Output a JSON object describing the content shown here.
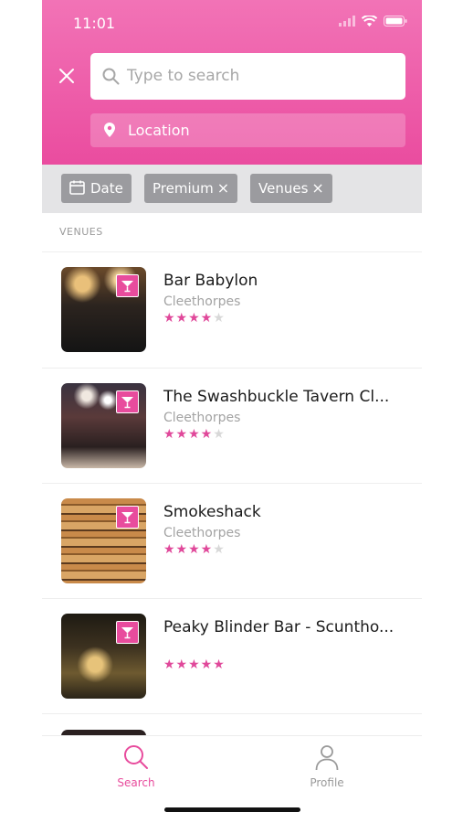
{
  "status_bar": {
    "time": "11:01"
  },
  "search": {
    "placeholder": "Type to search"
  },
  "location": {
    "label": "Location"
  },
  "filters": [
    {
      "label": "Date",
      "icon": "calendar-icon",
      "removable": false
    },
    {
      "label": "Premium",
      "removable": true
    },
    {
      "label": "Venues",
      "removable": true
    }
  ],
  "section_title": "VENUES",
  "venues": [
    {
      "name": "Bar Babylon",
      "city": "Cleethorpes",
      "rating": 4
    },
    {
      "name": "The Swashbuckle Tavern Cl...",
      "city": "Cleethorpes",
      "rating": 4
    },
    {
      "name": "Smokeshack",
      "city": "Cleethorpes",
      "rating": 4
    },
    {
      "name": "Peaky Blinder Bar - Scuntho...",
      "city": "",
      "rating": 5
    }
  ],
  "tabs": [
    {
      "label": "Search",
      "icon": "search-icon",
      "active": true
    },
    {
      "label": "Profile",
      "icon": "person-icon",
      "active": false
    }
  ],
  "colors": {
    "accent": "#e84c9d",
    "header_top": "#f273b6",
    "chip": "#9b9b9f"
  }
}
